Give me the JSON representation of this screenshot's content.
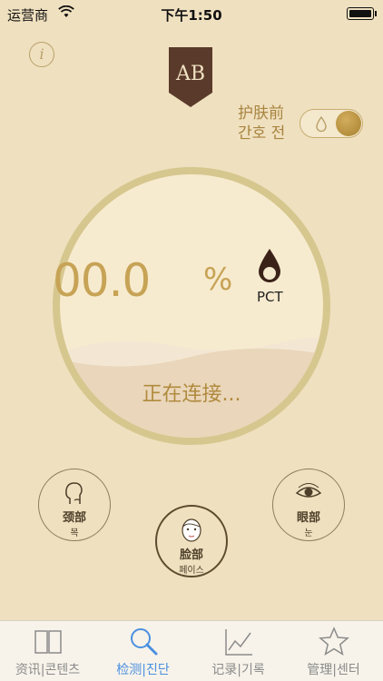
{
  "status_bar": {
    "carrier": "运营商",
    "time": "下午1:50"
  },
  "header": {
    "logo_text": "AB",
    "mode_label_line1": "护肤前",
    "mode_label_line2": "간호 전"
  },
  "gauge": {
    "value": "00.0",
    "unit": "%",
    "metric_label": "PCT",
    "status": "正在连接..."
  },
  "regions": {
    "neck": {
      "label": "颈部",
      "sub": "목"
    },
    "face": {
      "label": "脸部",
      "sub": "페이스"
    },
    "eye": {
      "label": "眼部",
      "sub": "눈"
    }
  },
  "tabs": [
    {
      "label": "资讯|콘텐츠",
      "icon": "book-icon",
      "active": false
    },
    {
      "label": "检测|진단",
      "icon": "search-icon",
      "active": true
    },
    {
      "label": "记录|기록",
      "icon": "chart-icon",
      "active": false
    },
    {
      "label": "管理|센터",
      "icon": "star-icon",
      "active": false
    }
  ],
  "colors": {
    "background": "#efe0bf",
    "gold": "#c7a356",
    "active_tab": "#4b8fe0",
    "logo": "#5a3a2a"
  }
}
